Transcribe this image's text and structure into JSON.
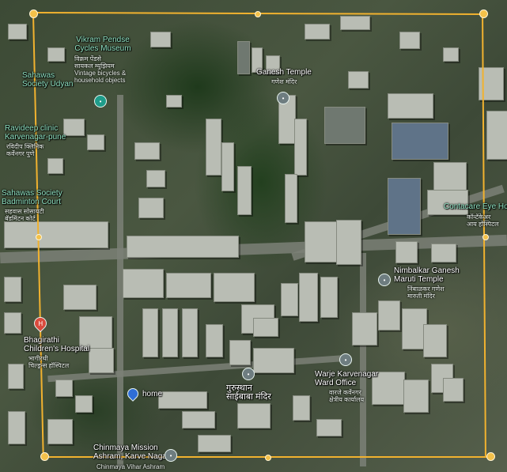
{
  "map": {
    "places": {
      "vikram": {
        "name_lines": [
          "Vikram Pendse",
          "Cycles Museum"
        ],
        "local_lines": [
          "विक्रम पेंडसे",
          "सायकल म्युझियम"
        ],
        "extra": [
          "Vintage bicycles &",
          "household objects"
        ]
      },
      "sahawas_udyan": {
        "name": "Sahawas",
        "name2": "Society Udyan"
      },
      "ganesh_temple": {
        "name": "Ganesh Temple",
        "local": "गणेश मंदिर"
      },
      "ravideep": {
        "name_lines": [
          "Ravideep clinic",
          "Karvenagar-pune"
        ],
        "local_lines": [
          "रविदीप क्लिनिक",
          "कर्वेनगर पुणे"
        ]
      },
      "sahawas_badminton": {
        "name_lines": [
          "Sahawas Society",
          "Badminton Court"
        ],
        "local_lines": [
          "सहवास सोसायटी",
          "बॅडमिंटन कोर्ट"
        ]
      },
      "contacare": {
        "name": "Contacare Eye Hos",
        "local_lines": [
          "कॉन्टॅकेअर",
          "आय हॉस्पिटल"
        ]
      },
      "nimbalkar": {
        "name_lines": [
          "Nimbalkar Ganesh",
          "Maruti Temple"
        ],
        "local_lines": [
          "निंबाळकर गणेश",
          "मारुती मंदिर"
        ]
      },
      "bhagirathi": {
        "name_lines": [
          "Bhagirathi",
          "Children's Hospital"
        ],
        "local_lines": [
          "भागीरथी",
          "चिल्ड्रन्स हॉस्पिटल"
        ]
      },
      "warje": {
        "name_lines": [
          "Warje Karvenagar",
          "Ward Office"
        ],
        "local_lines": [
          "वारजे कर्वेनगर",
          "क्षेत्रीय कार्यालय"
        ]
      },
      "home": {
        "name": "home"
      },
      "saibaba": {
        "local_lines": [
          "गुरुस्थान",
          "साईबाबा मंदिर"
        ]
      },
      "chinmaya": {
        "name_lines": [
          "Chinmaya Mission",
          "Ashram, Karve Nagar"
        ],
        "local": "Chinmaya Vihar Ashram"
      }
    },
    "colors": {
      "boundary": "#f1b22f",
      "label": "#8ee0c0",
      "home_pin": "#2f6ed6",
      "hospital_pin": "#d94b3e"
    },
    "icons": [
      "teal-place-pin-icon",
      "gray-place-pin-icon",
      "hospital-pin-icon",
      "home-location-pin-icon"
    ]
  }
}
